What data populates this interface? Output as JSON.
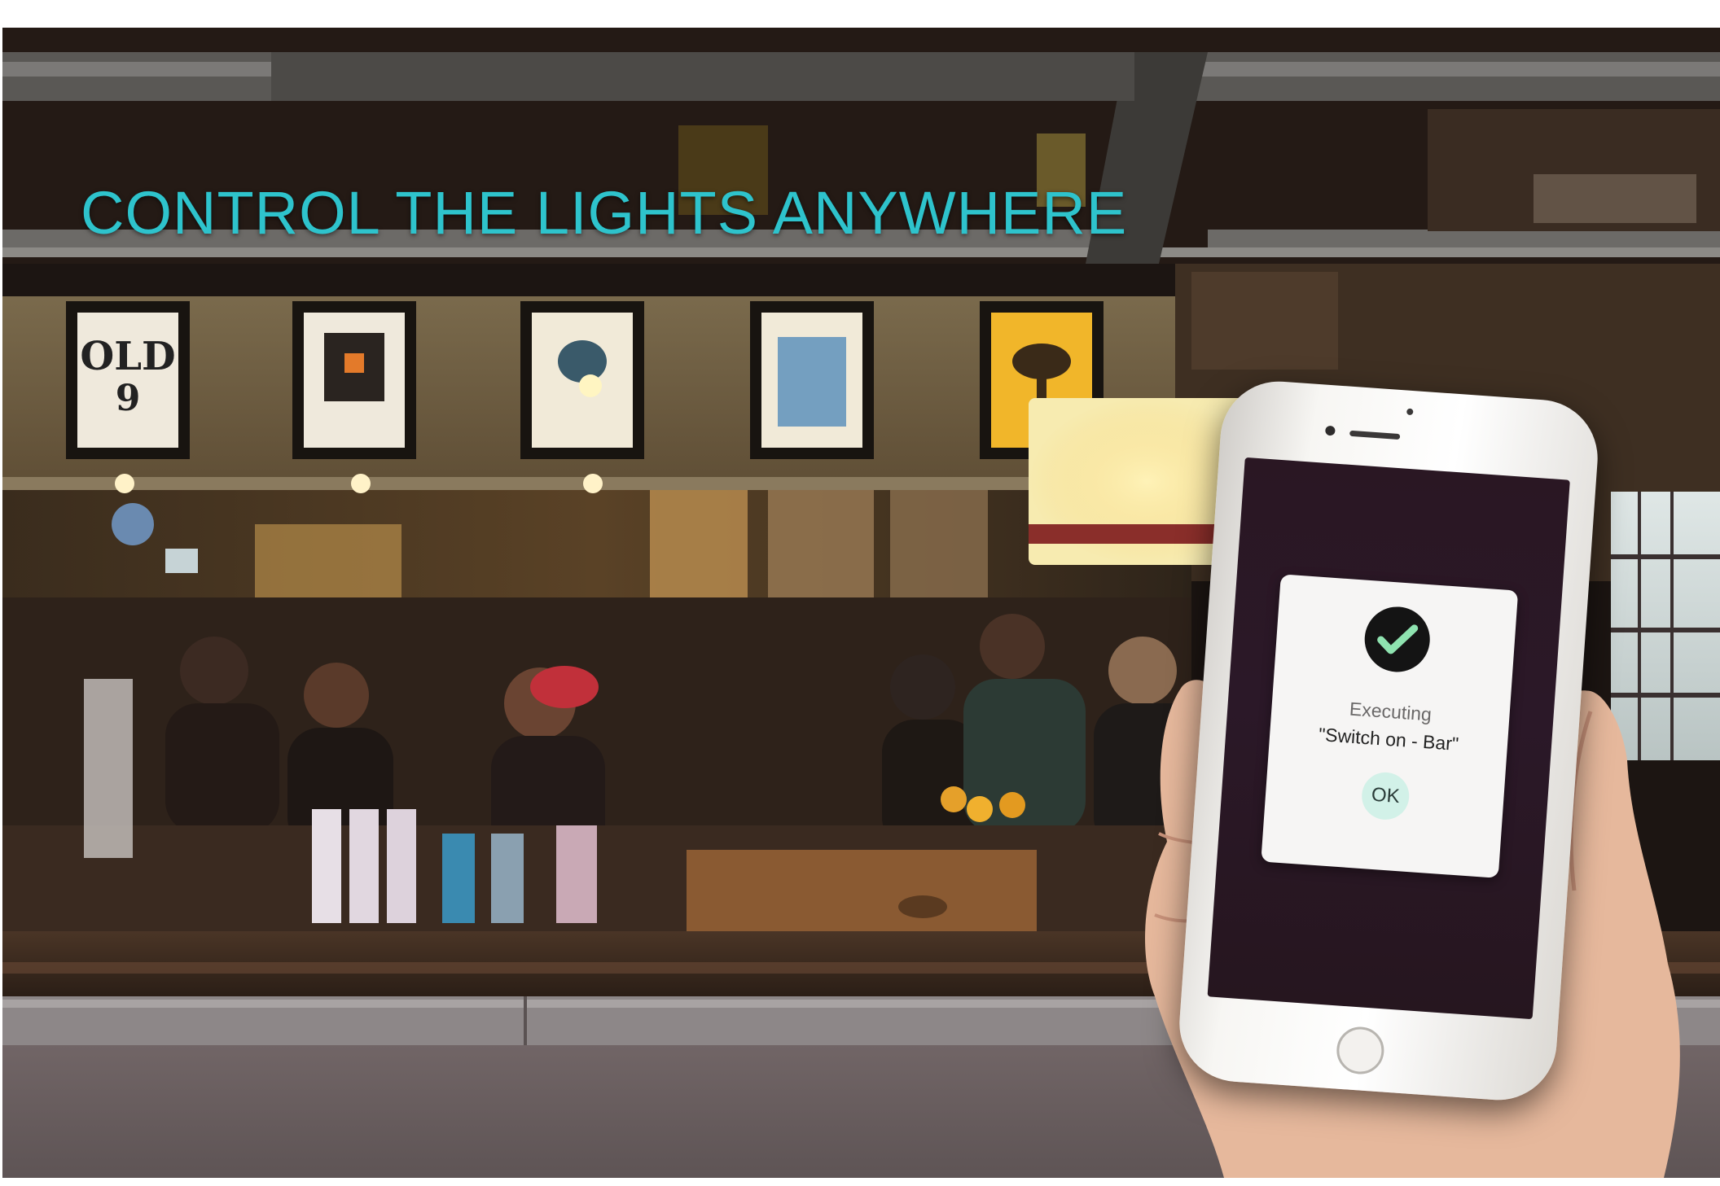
{
  "headline": "CONTROL THE LIGHTS ANYWHERE",
  "dialog": {
    "status_label": "Executing",
    "command_label": "\"Switch on - Bar\"",
    "ok_label": "OK",
    "icon": "check-circle-icon"
  },
  "colors": {
    "headline": "#2ec3cc",
    "dialog_background": "#f6f5f4",
    "ok_button": "#d2f1e8",
    "screen_background": "#2a1723"
  }
}
